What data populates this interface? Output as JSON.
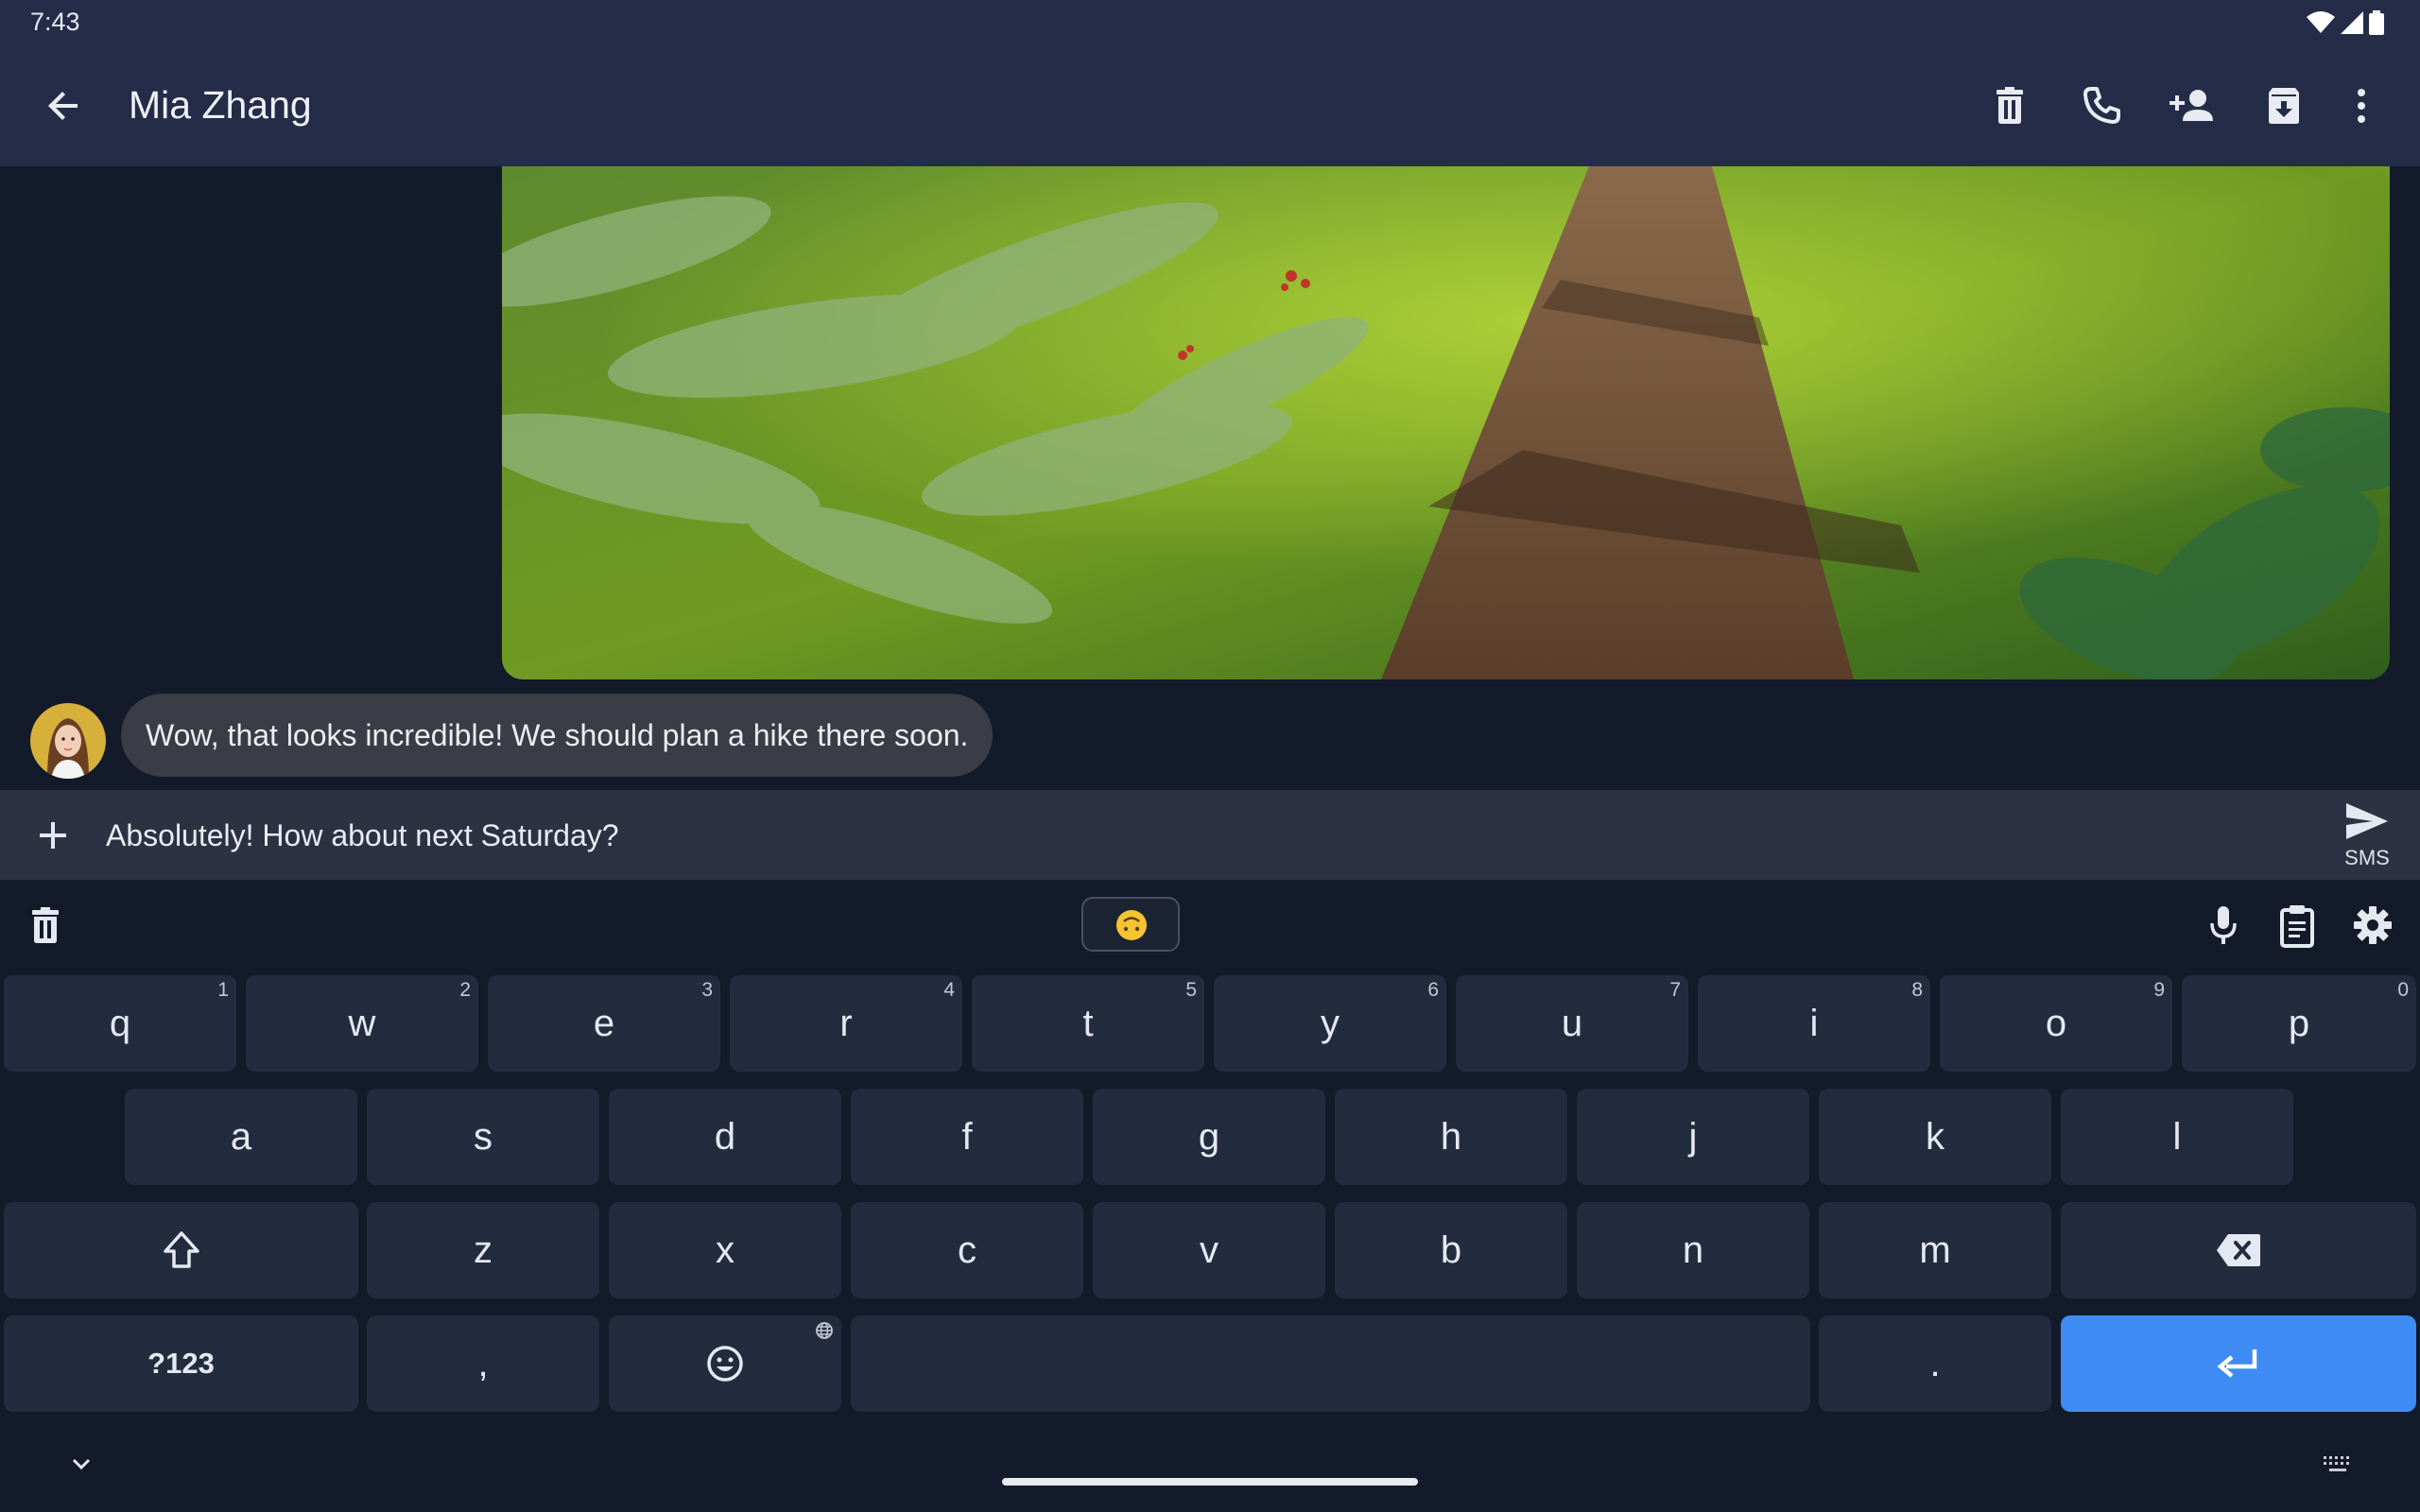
{
  "status_bar": {
    "time": "7:43",
    "icons": [
      "wifi-icon",
      "signal-icon",
      "battery-icon"
    ]
  },
  "app_bar": {
    "title": "Mia Zhang",
    "back_icon": "arrow-left-icon",
    "actions": [
      "delete-icon",
      "phone-icon",
      "add-contact-icon",
      "archive-icon",
      "more-vert-icon"
    ]
  },
  "conversation": {
    "image_description_icon": "forest-path-photo",
    "incoming_message": "Wow, that looks incredible! We should plan a hike there soon."
  },
  "compose": {
    "add_icon": "plus-icon",
    "draft_text": "Absolutely! How about next Saturday?",
    "send_label": "SMS",
    "send_icon": "send-icon"
  },
  "keyboard": {
    "toolbar_icons": [
      "delete-icon",
      "emoji-upside-down-icon",
      "mic-icon",
      "clipboard-icon",
      "settings-icon"
    ],
    "row1": [
      {
        "key": "q",
        "hint": "1"
      },
      {
        "key": "w",
        "hint": "2"
      },
      {
        "key": "e",
        "hint": "3"
      },
      {
        "key": "r",
        "hint": "4"
      },
      {
        "key": "t",
        "hint": "5"
      },
      {
        "key": "y",
        "hint": "6"
      },
      {
        "key": "u",
        "hint": "7"
      },
      {
        "key": "i",
        "hint": "8"
      },
      {
        "key": "o",
        "hint": "9"
      },
      {
        "key": "p",
        "hint": "0"
      }
    ],
    "row2": [
      "a",
      "s",
      "d",
      "f",
      "g",
      "h",
      "j",
      "k",
      "l"
    ],
    "row3": [
      "z",
      "x",
      "c",
      "v",
      "b",
      "n",
      "m"
    ],
    "row4": {
      "symbols": "?123",
      "comma": ",",
      "period": "."
    },
    "colors": {
      "key_bg": "#232c3f",
      "enter_bg": "#3e8bf3",
      "app_bar_bg": "#252c48"
    }
  }
}
